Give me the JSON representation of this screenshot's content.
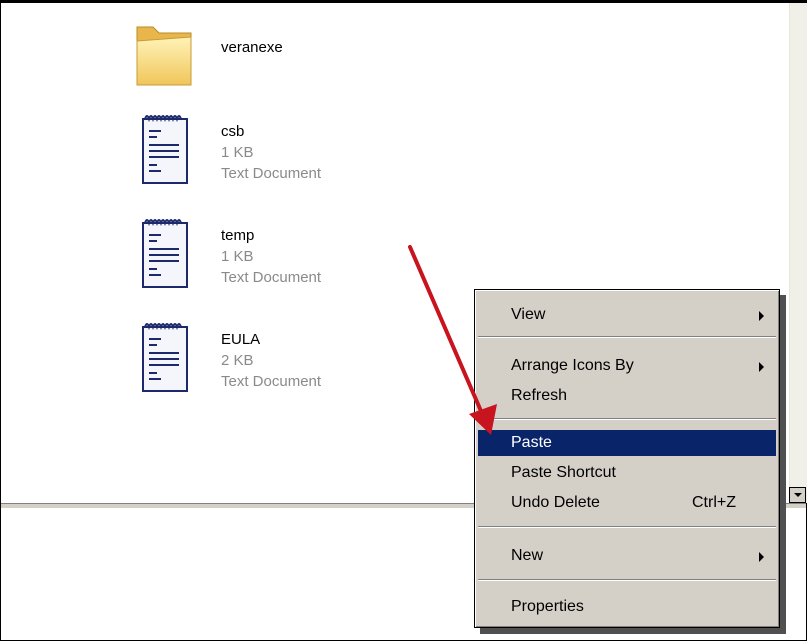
{
  "files": [
    {
      "name": "veranexe",
      "icon": "folder-icon"
    },
    {
      "name": "csb",
      "size": "1 KB",
      "type": "Text Document",
      "icon": "text-document-icon"
    },
    {
      "name": "temp",
      "size": "1 KB",
      "type": "Text Document",
      "icon": "text-document-icon"
    },
    {
      "name": "EULA",
      "size": "2 KB",
      "type": "Text Document",
      "icon": "text-document-icon"
    }
  ],
  "context_menu": {
    "view": "View",
    "arrange_icons_by": "Arrange Icons By",
    "refresh": "Refresh",
    "paste": "Paste",
    "paste_shortcut": "Paste Shortcut",
    "undo_delete": "Undo Delete",
    "undo_delete_shortcut": "Ctrl+Z",
    "new": "New",
    "properties": "Properties",
    "highlighted": "Paste"
  },
  "colors": {
    "highlight": "#0a246a",
    "menu_bg": "#d4d0c8",
    "annotation_arrow": "#c8141e"
  }
}
